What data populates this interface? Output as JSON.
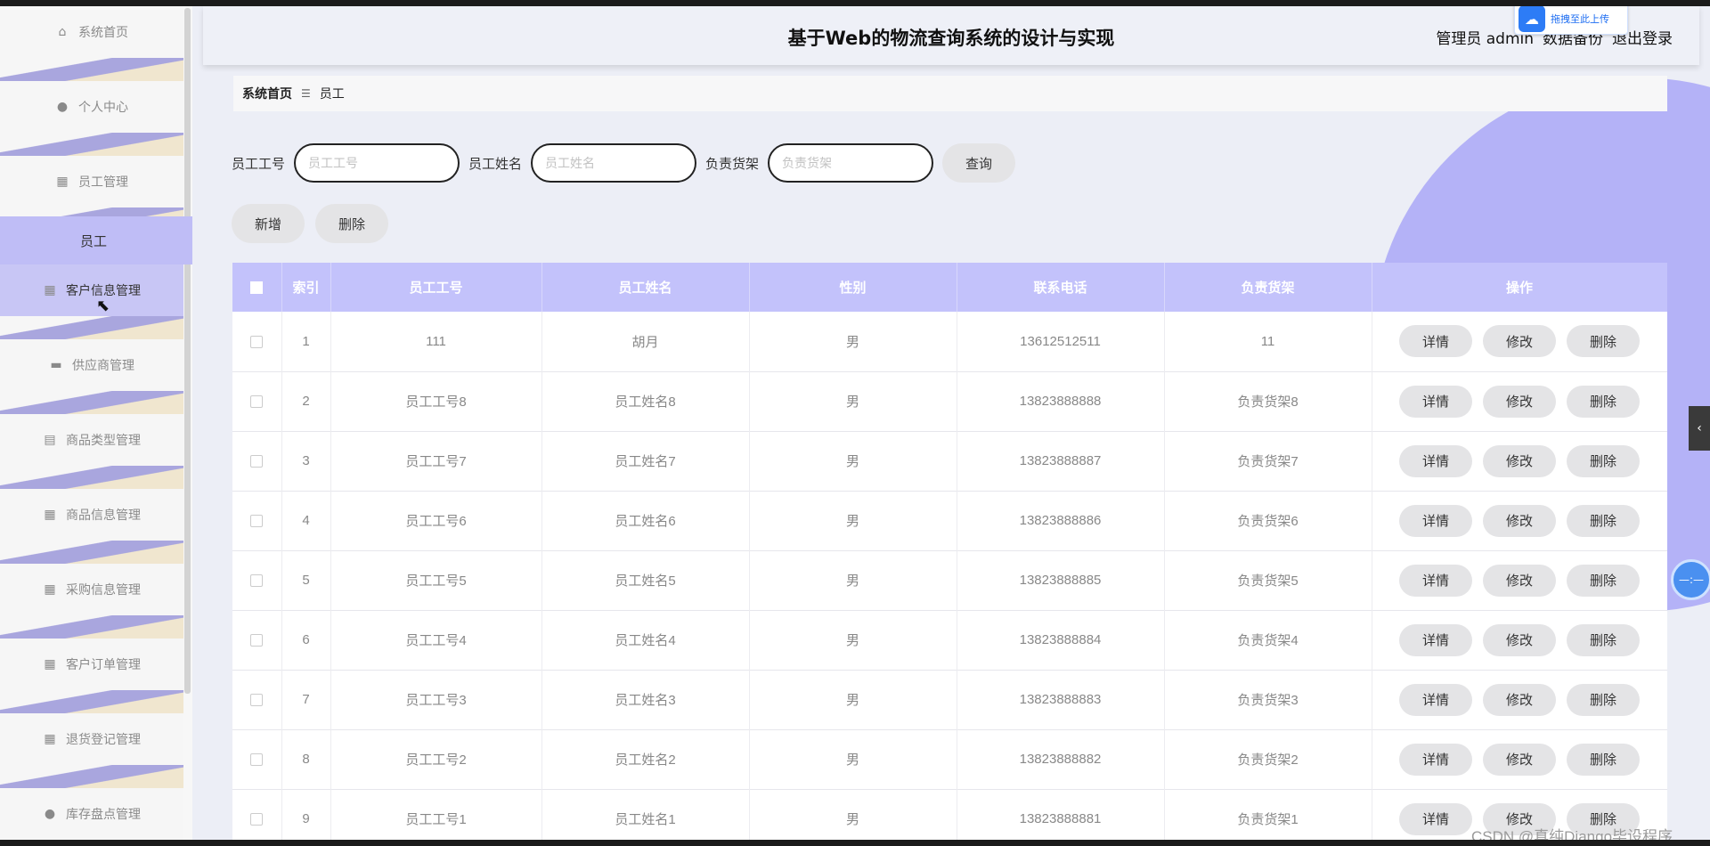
{
  "sidebar": {
    "items": [
      {
        "label": "系统首页",
        "icon": "home-icon",
        "glyph": "⌂"
      },
      {
        "label": "个人中心",
        "icon": "user-icon",
        "glyph": "●"
      },
      {
        "label": "员工管理",
        "icon": "grid-icon",
        "glyph": "▦"
      },
      {
        "label": "客户信息管理",
        "icon": "grid-icon",
        "glyph": "▦"
      },
      {
        "label": "供应商管理",
        "icon": "briefcase-icon",
        "glyph": "▬"
      },
      {
        "label": "商品类型管理",
        "icon": "clipboard-icon",
        "glyph": "▤"
      },
      {
        "label": "商品信息管理",
        "icon": "grid-icon",
        "glyph": "▦"
      },
      {
        "label": "采购信息管理",
        "icon": "grid-icon",
        "glyph": "▦"
      },
      {
        "label": "客户订单管理",
        "icon": "grid-icon",
        "glyph": "▦"
      },
      {
        "label": "退货登记管理",
        "icon": "grid-icon",
        "glyph": "▦"
      },
      {
        "label": "库存盘点管理",
        "icon": "user-icon",
        "glyph": "●"
      }
    ],
    "submenu_label": "员工"
  },
  "header": {
    "title": "基于Web的物流查询系统的设计与实现",
    "role": "管理员 admin",
    "backup": "数据备份",
    "logout": "退出登录",
    "upload_badge": "拖拽至此上传"
  },
  "breadcrumb": {
    "home": "系统首页",
    "sep": "☰",
    "current": "员工"
  },
  "search": {
    "employee_no_label": "员工工号",
    "employee_no_placeholder": "员工工号",
    "employee_name_label": "员工姓名",
    "employee_name_placeholder": "员工姓名",
    "shelf_label": "负责货架",
    "shelf_placeholder": "负责货架",
    "query_button": "查询"
  },
  "actions": {
    "add": "新增",
    "delete": "删除"
  },
  "table": {
    "headers": [
      "",
      "索引",
      "员工工号",
      "员工姓名",
      "性别",
      "联系电话",
      "负责货架",
      "操作"
    ],
    "op_labels": [
      "详情",
      "修改",
      "删除"
    ],
    "rows": [
      [
        "1",
        "111",
        "胡月",
        "男",
        "13612512511",
        "11"
      ],
      [
        "2",
        "员工工号8",
        "员工姓名8",
        "男",
        "13823888888",
        "负责货架8"
      ],
      [
        "3",
        "员工工号7",
        "员工姓名7",
        "男",
        "13823888887",
        "负责货架7"
      ],
      [
        "4",
        "员工工号6",
        "员工姓名6",
        "男",
        "13823888886",
        "负责货架6"
      ],
      [
        "5",
        "员工工号5",
        "员工姓名5",
        "男",
        "13823888885",
        "负责货架5"
      ],
      [
        "6",
        "员工工号4",
        "员工姓名4",
        "男",
        "13823888884",
        "负责货架4"
      ],
      [
        "7",
        "员工工号3",
        "员工姓名3",
        "男",
        "13823888883",
        "负责货架3"
      ],
      [
        "8",
        "员工工号2",
        "员工姓名2",
        "男",
        "13823888882",
        "负责货架2"
      ],
      [
        "9",
        "员工工号1",
        "员工姓名1",
        "男",
        "13823888881",
        "负责货架1"
      ]
    ]
  },
  "widgets": {
    "side_tab_glyph": "‹",
    "float_ball_text": "—:—",
    "watermark": "CSDN @真纯Django毕设程序"
  }
}
